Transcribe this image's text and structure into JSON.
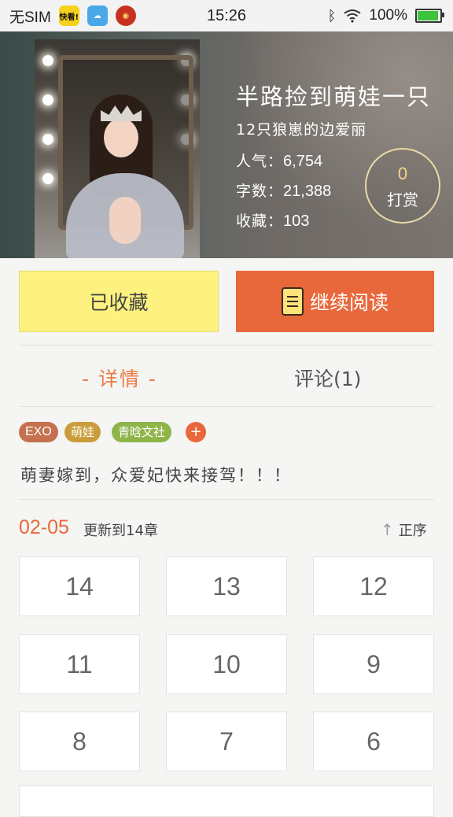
{
  "status_bar": {
    "carrier": "无SIM",
    "apps": [
      "快看!",
      "",
      ""
    ],
    "time": "15:26",
    "battery": "100%",
    "battery_level": 1.0
  },
  "book": {
    "title": "半路捡到萌娃一只",
    "author": "12只狼崽的边爱丽",
    "stats": [
      {
        "label": "人气：",
        "value": "6,754"
      },
      {
        "label": "字数：",
        "value": "21,388"
      },
      {
        "label": "收藏：",
        "value": "103"
      }
    ],
    "reward": {
      "count": "0",
      "label": "打赏"
    }
  },
  "actions": {
    "favorited_label": "已收藏",
    "continue_label": "继续阅读"
  },
  "tabs": [
    {
      "label": "- 详情 -",
      "active": true
    },
    {
      "label": "评论(1)",
      "active": false
    }
  ],
  "tags": [
    "EXO",
    "萌娃",
    "青晗文社",
    "+"
  ],
  "intro": "萌妻嫁到，众爱妃快来接驾！！！",
  "update": {
    "date": "02-05",
    "text": "更新到14章",
    "sort_label": "正序"
  },
  "chapters": [
    "14",
    "13",
    "12",
    "11",
    "10",
    "9",
    "8",
    "7",
    "6"
  ],
  "colors": {
    "accent": "#e8683b",
    "favorite_bg": "#fdf27f",
    "tab_active": "#ec7a44"
  }
}
